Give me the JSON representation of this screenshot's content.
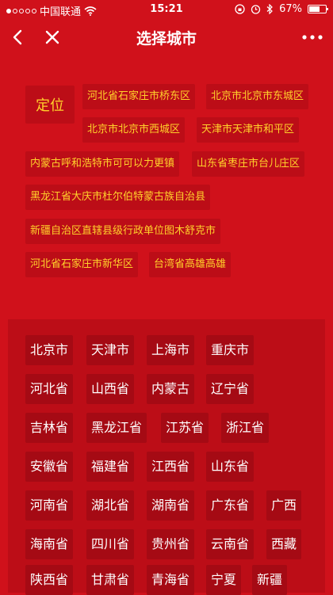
{
  "status": {
    "carrier": "中国联通",
    "time": "15:21",
    "battery": "67%",
    "signal_bars": 1,
    "signal_total": 5,
    "battery_level": 0.67
  },
  "nav": {
    "title": "选择城市",
    "back_icon": "chevron-left-icon",
    "close_icon": "close-icon",
    "more_icon": "more-dots-icon"
  },
  "locate": {
    "label": "定位",
    "cities": [
      "河北省石家庄市桥东区",
      "北京市北京市东城区",
      "北京市北京市西城区",
      "天津市天津市和平区",
      "内蒙古呼和浩特市可可以力更镇",
      "山东省枣庄市台儿庄区",
      "黑龙江省大庆市杜尔伯特蒙古族自治县",
      "新疆自治区直辖县级行政单位图木舒克市",
      "河北省石家庄市新华区",
      "台湾省高雄高雄"
    ]
  },
  "provinces": [
    "北京市",
    "天津市",
    "上海市",
    "重庆市",
    "河北省",
    "山西省",
    "内蒙古",
    "辽宁省",
    "吉林省",
    "黑龙江省",
    "江苏省",
    "浙江省",
    "安徽省",
    "福建省",
    "江西省",
    "山东省",
    "河南省",
    "湖北省",
    "湖南省",
    "广东省",
    "广西",
    "海南省",
    "四川省",
    "贵州省",
    "云南省",
    "西藏",
    "陕西省",
    "甘肃省",
    "青海省",
    "宁夏",
    "新疆"
  ],
  "colors": {
    "background": "#d0111b",
    "chip": "#bc0d17",
    "province_chip": "#a50a14",
    "accent_text": "#ffd12b"
  }
}
